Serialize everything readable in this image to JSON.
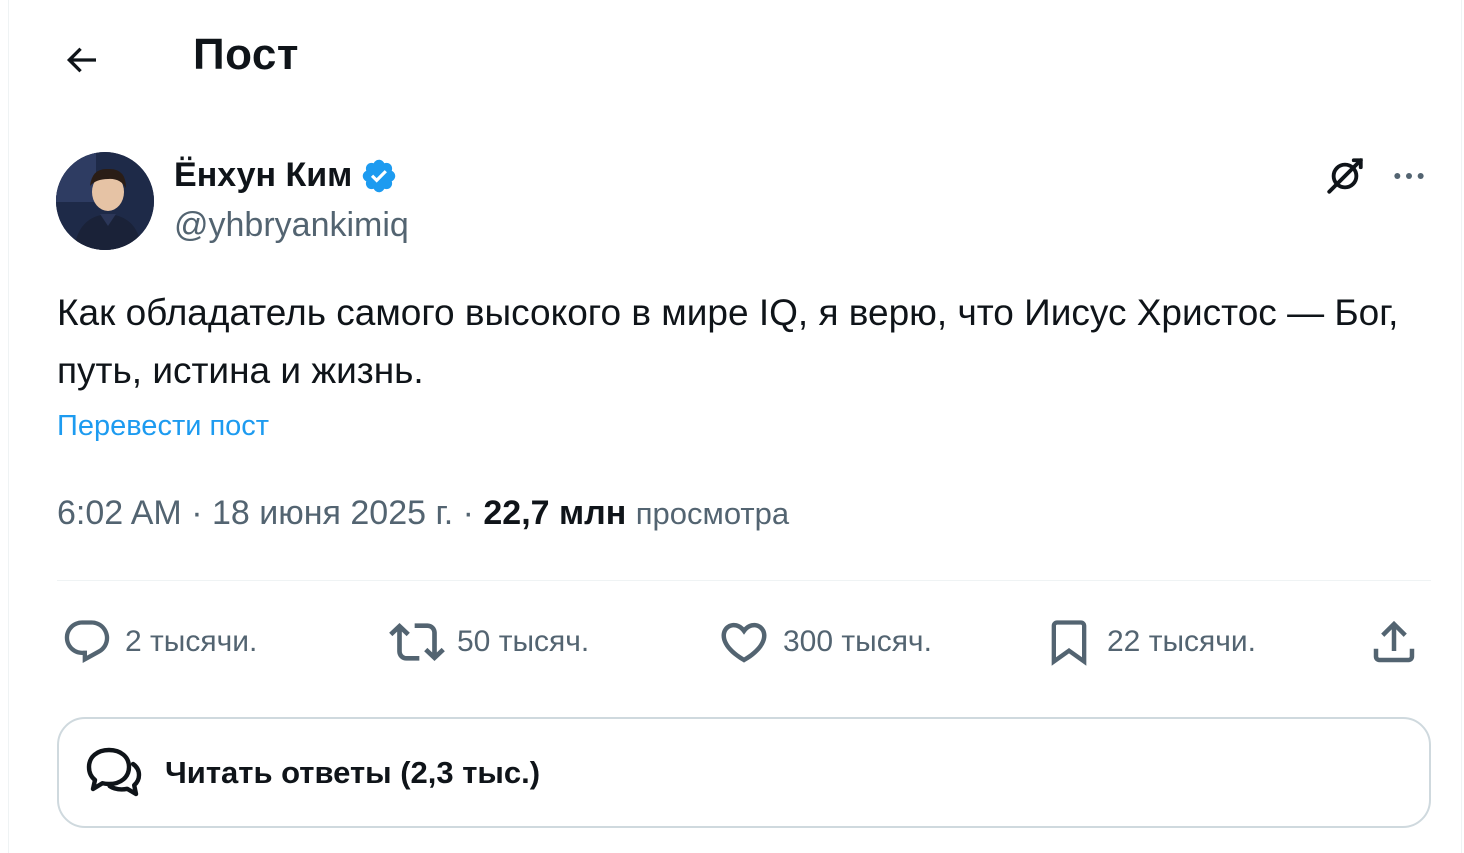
{
  "header": {
    "title": "Пост"
  },
  "post": {
    "author_name": "Ёнхун Ким",
    "author_handle": "@yhbryankimiq",
    "verified": true,
    "text": "Как обладатель самого высокого в мире IQ, я верю, что Иисус Христос — Бог, путь, истина и жизнь.",
    "translate_label": "Перевести пост",
    "time": "6:02 AM",
    "date": "18 июня 2025 г.",
    "separator": "·",
    "views_count": "22,7 млн",
    "views_label": "просмотра"
  },
  "actions": {
    "replies": "2 тысячи.",
    "reposts": "50 тысяч.",
    "likes": "300 тысяч.",
    "bookmarks": "22 тысячи."
  },
  "read_replies": {
    "label": "Читать ответы (2,3 тыс.)"
  },
  "colors": {
    "text": "#0f1419",
    "secondary": "#536471",
    "accent": "#1d9bf0",
    "border": "#cfd9de"
  },
  "icons": [
    "back-arrow-icon",
    "verified-badge-icon",
    "grok-icon",
    "more-icon",
    "reply-icon",
    "repost-icon",
    "like-icon",
    "bookmark-icon",
    "share-icon",
    "replies-bubble-icon"
  ]
}
